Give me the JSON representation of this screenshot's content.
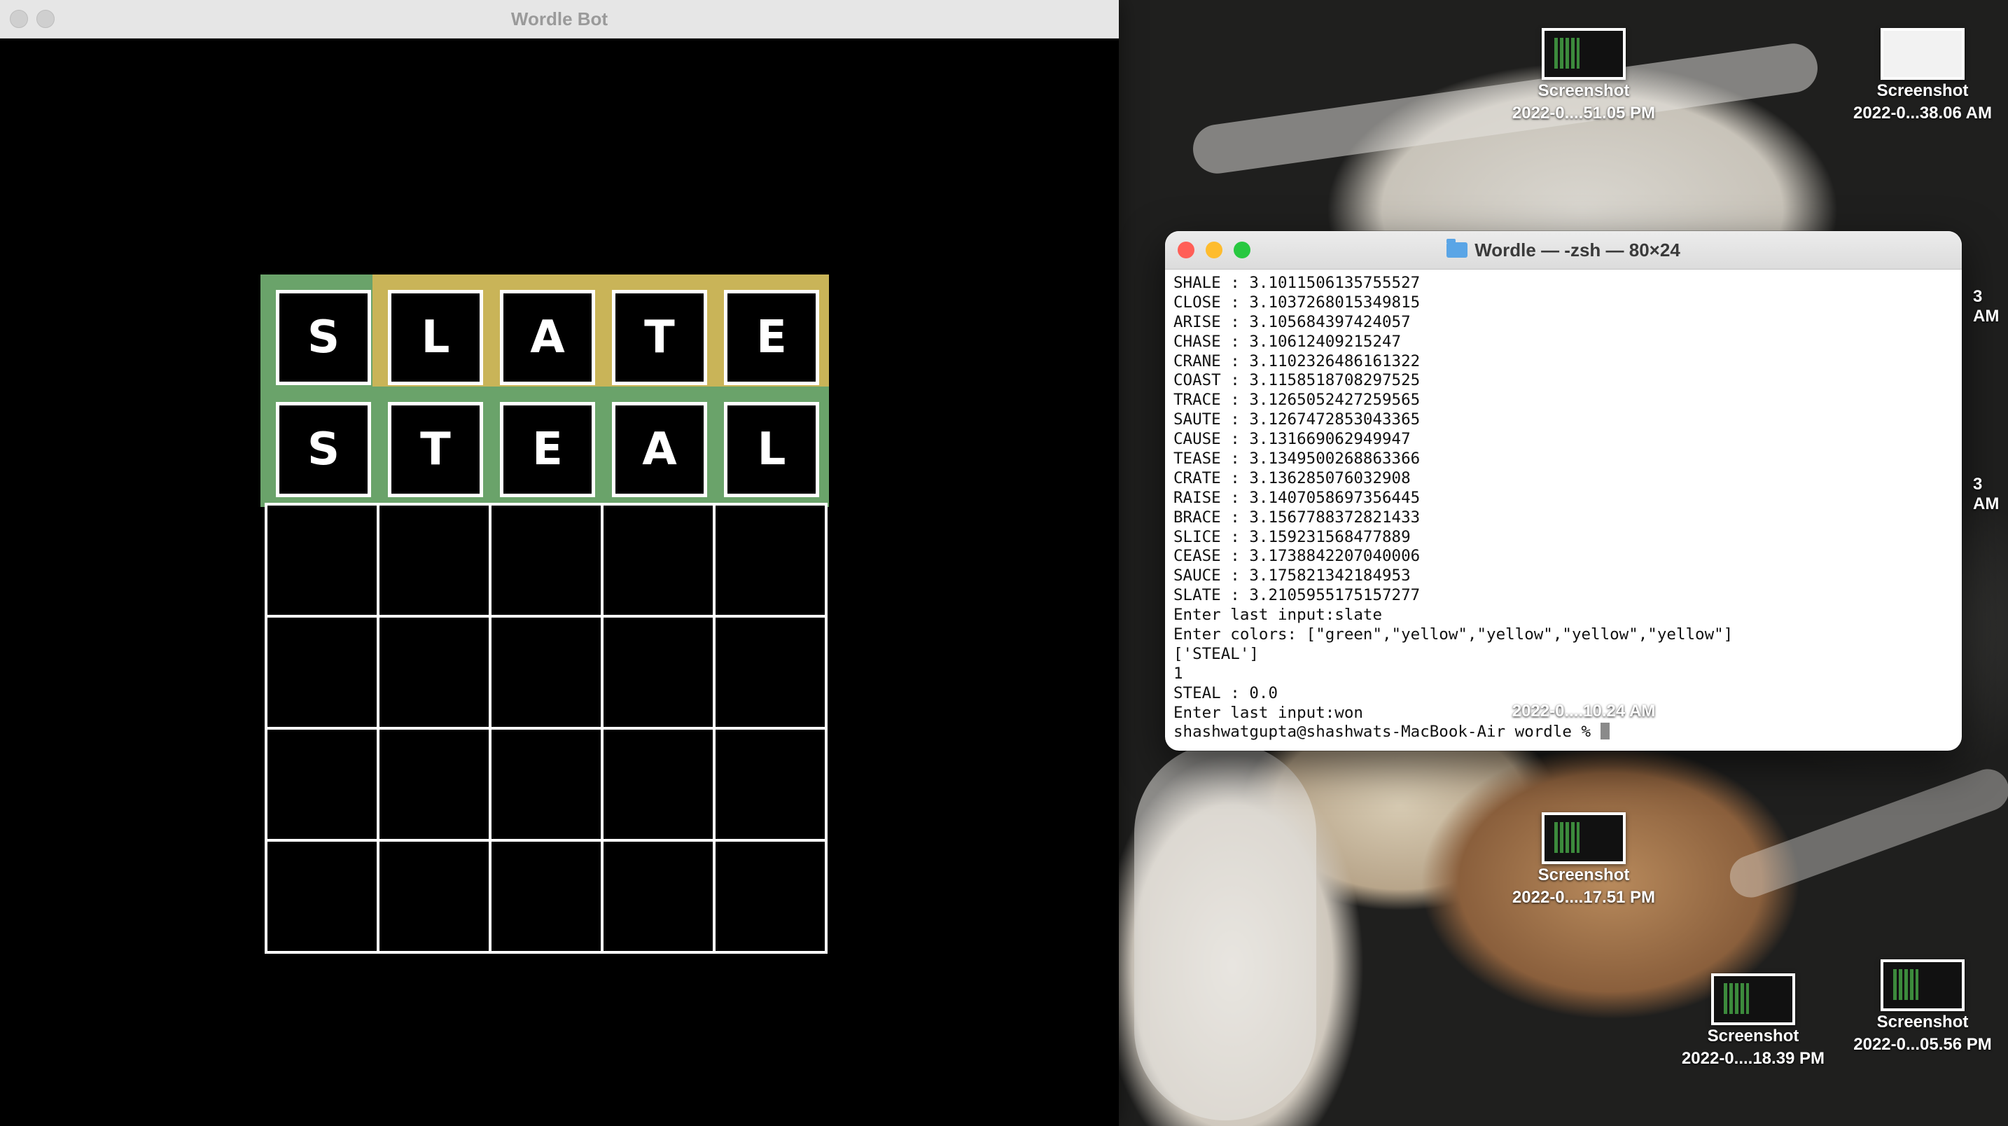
{
  "wordle_window": {
    "title": "Wordle Bot",
    "rows": [
      {
        "letters": [
          "S",
          "L",
          "A",
          "T",
          "E"
        ],
        "colors": [
          "green",
          "yellow",
          "yellow",
          "yellow",
          "yellow"
        ]
      },
      {
        "letters": [
          "S",
          "T",
          "E",
          "A",
          "L"
        ],
        "colors": [
          "green",
          "green",
          "green",
          "green",
          "green"
        ]
      }
    ],
    "empty_rows": 4,
    "palette": {
      "green": "#6aa36a",
      "yellow": "#c9b458",
      "background": "#000000",
      "grid": "#ffffff"
    }
  },
  "terminal": {
    "title": "Wordle — -zsh — 80×24",
    "lines": [
      "SHALE : 3.1011506135755527",
      "CLOSE : 3.1037268015349815",
      "ARISE : 3.105684397424057",
      "CHASE : 3.10612409215247",
      "CRANE : 3.1102326486161322",
      "COAST : 3.1158518708297525",
      "TRACE : 3.1265052427259565",
      "SAUTE : 3.1267472853043365",
      "CAUSE : 3.131669062949947",
      "TEASE : 3.1349500268863366",
      "CRATE : 3.136285076032908",
      "RAISE : 3.1407058697356445",
      "BRACE : 3.1567788372821433",
      "SLICE : 3.159231568477889",
      "CEASE : 3.1738842207040006",
      "SAUCE : 3.175821342184953",
      "SLATE : 3.2105955175157277",
      "Enter last input:slate",
      "Enter colors: [\"green\",\"yellow\",\"yellow\",\"yellow\",\"yellow\"]",
      "['STEAL']",
      "1",
      "STEAL : 0.0",
      "Enter last input:won"
    ],
    "prompt": "shashwatgupta@shashwats-MacBook-Air wordle % "
  },
  "desktop_icons": [
    {
      "name": "Screenshot",
      "date": "2022-0....51.05 PM",
      "thumb": "dark"
    },
    {
      "name": "Screenshot",
      "date": "2022-0...38.06 AM",
      "thumb": "light"
    },
    {
      "name": "",
      "date": "2022-0....10.24 AM",
      "thumb": "hidden"
    },
    {
      "name": "Screenshot",
      "date": "2022-0....17.51 PM",
      "thumb": "dark"
    },
    {
      "name": "Screenshot",
      "date": "2022-0....18.39 PM",
      "thumb": "dark"
    },
    {
      "name": "Screenshot",
      "date": "2022-0...05.56 PM",
      "thumb": "dark"
    }
  ],
  "partial_labels": [
    "3 AM",
    "3 AM"
  ]
}
